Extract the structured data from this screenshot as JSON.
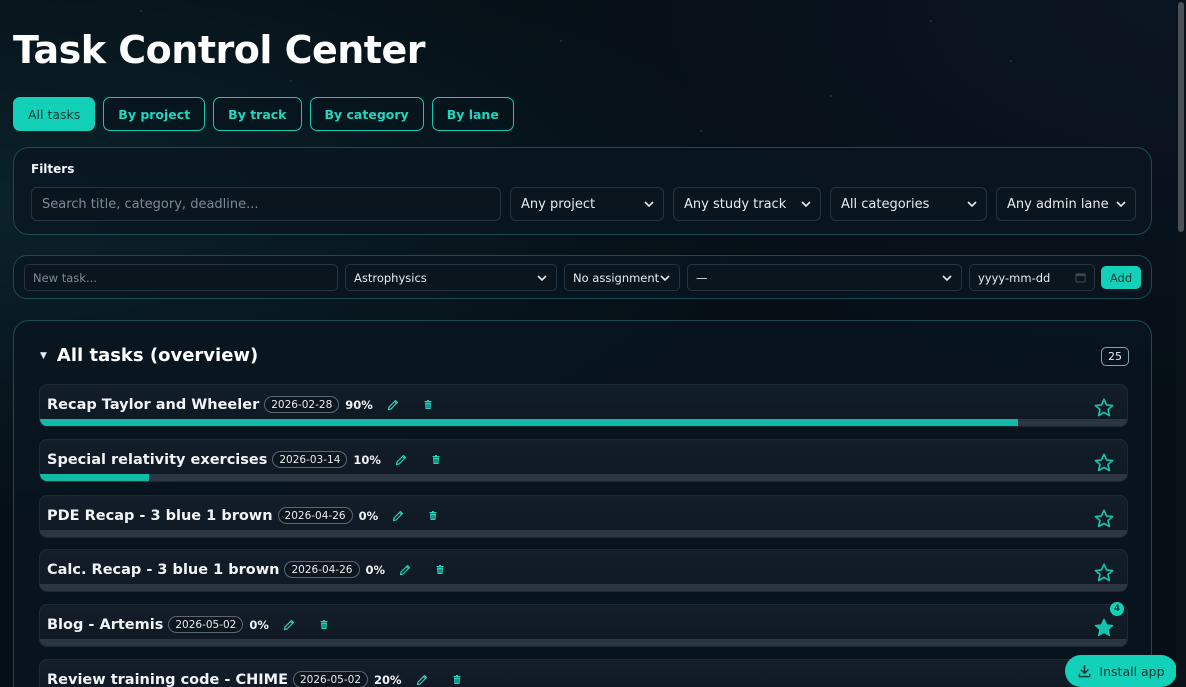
{
  "page": {
    "title": "Task Control Center"
  },
  "view_tabs": [
    {
      "label": "All tasks",
      "active": true
    },
    {
      "label": "By project",
      "active": false
    },
    {
      "label": "By track",
      "active": false
    },
    {
      "label": "By category",
      "active": false
    },
    {
      "label": "By lane",
      "active": false
    }
  ],
  "filters": {
    "title": "Filters",
    "search_placeholder": "Search title, category, deadline...",
    "project_select": "Any project",
    "track_select": "Any study track",
    "category_select": "All categories",
    "lane_select": "Any admin lane"
  },
  "new_task": {
    "placeholder": "New task...",
    "project_select": "Astrophysics",
    "assignment_select": "No assignment",
    "extra_select": "—",
    "date_placeholder": "yyyy-mm-dd",
    "add_label": "Add"
  },
  "task_list": {
    "title": "All tasks (overview)",
    "count": "25",
    "tasks": [
      {
        "title": "Recap Taylor and Wheeler",
        "date": "2026-02-28",
        "percent_label": "90%",
        "progress": 0.9,
        "starred": false
      },
      {
        "title": "Special relativity exercises",
        "date": "2026-03-14",
        "percent_label": "10%",
        "progress": 0.1,
        "starred": false
      },
      {
        "title": "PDE Recap - 3 blue 1 brown",
        "date": "2026-04-26",
        "percent_label": "0%",
        "progress": 0,
        "starred": false
      },
      {
        "title": "Calc. Recap - 3 blue 1 brown",
        "date": "2026-04-26",
        "percent_label": "0%",
        "progress": 0,
        "starred": false
      },
      {
        "title": "Blog - Artemis",
        "date": "2026-05-02",
        "percent_label": "0%",
        "progress": 0,
        "starred": true,
        "star_count": "4"
      },
      {
        "title": "Review training code - CHIME",
        "date": "2026-05-02",
        "percent_label": "20%",
        "progress": 0.2,
        "starred": false
      }
    ]
  },
  "install_button": {
    "label": "Install app"
  },
  "colors": {
    "accent": "#12d1b8",
    "background": "#060f16",
    "progress": "#12b9a4"
  },
  "icons": [
    "chevron-down-icon",
    "pencil-icon",
    "trash-icon",
    "star-icon",
    "download-icon",
    "calendar-icon",
    "caret-down-icon"
  ]
}
